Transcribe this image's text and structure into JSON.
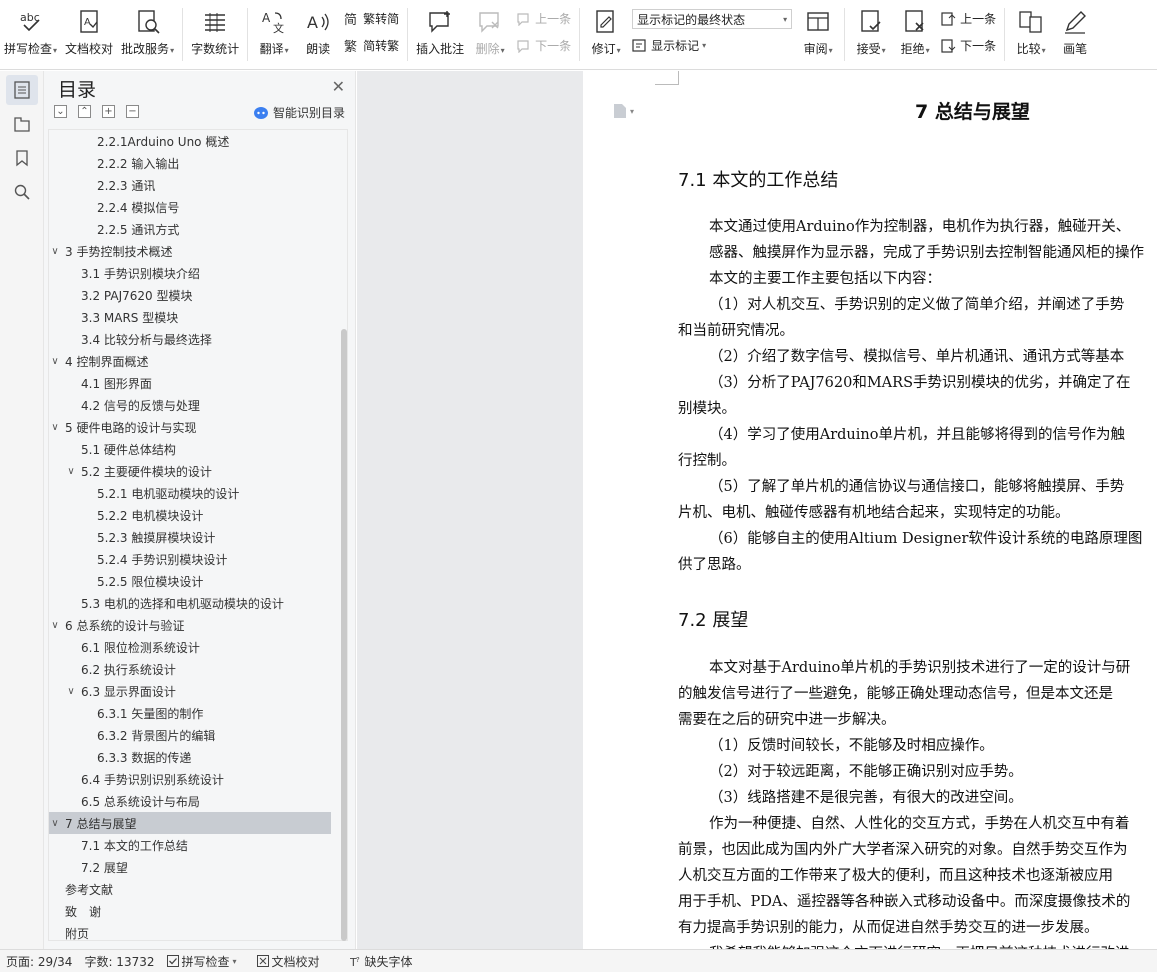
{
  "ribbon": {
    "spell_check": "拼写检查",
    "doc_proof": "文档校对",
    "batch_service": "批改服务",
    "word_count": "字数统计",
    "translate": "翻译",
    "read_aloud": "朗读",
    "trad_to_simp": "繁转简",
    "simp_to_trad": "简转繁",
    "insert_comment": "插入批注",
    "delete": "删除",
    "prev_comment": "上一条",
    "next_comment": "下一条",
    "revise": "修订",
    "markup_mode": "显示标记的最终状态",
    "show_markup": "显示标记",
    "review": "审阅",
    "accept": "接受",
    "reject": "拒绝",
    "prev_change": "上一条",
    "next_change": "下一条",
    "compare": "比较",
    "ink": "画笔"
  },
  "toc": {
    "title": "目录",
    "ai_label": "智能识别目录",
    "items": [
      {
        "text": "2.2.1Arduino Uno 概述",
        "level": 3
      },
      {
        "text": "2.2.2 输入输出",
        "level": 3
      },
      {
        "text": "2.2.3 通讯",
        "level": 3
      },
      {
        "text": "2.2.4 模拟信号",
        "level": 3
      },
      {
        "text": "2.2.5 通讯方式",
        "level": 3
      },
      {
        "text": "3 手势控制技术概述",
        "level": 1,
        "chevron": true
      },
      {
        "text": "3.1 手势识别模块介绍",
        "level": 2
      },
      {
        "text": "3.2 PAJ7620 型模块",
        "level": 2
      },
      {
        "text": "3.3 MARS 型模块",
        "level": 2
      },
      {
        "text": "3.4 比较分析与最终选择",
        "level": 2
      },
      {
        "text": "4 控制界面概述",
        "level": 1,
        "chevron": true
      },
      {
        "text": "4.1 图形界面",
        "level": 2
      },
      {
        "text": "4.2 信号的反馈与处理",
        "level": 2
      },
      {
        "text": "5 硬件电路的设计与实现",
        "level": 1,
        "chevron": true
      },
      {
        "text": "5.1 硬件总体结构",
        "level": 2
      },
      {
        "text": "5.2 主要硬件模块的设计",
        "level": 2,
        "chevron": true
      },
      {
        "text": "5.2.1 电机驱动模块的设计",
        "level": 3
      },
      {
        "text": "5.2.2 电机模块设计",
        "level": 3
      },
      {
        "text": "5.2.3 触摸屏模块设计",
        "level": 3
      },
      {
        "text": "5.2.4 手势识别模块设计",
        "level": 3
      },
      {
        "text": "5.2.5 限位模块设计",
        "level": 3
      },
      {
        "text": "5.3 电机的选择和电机驱动模块的设计",
        "level": 2
      },
      {
        "text": "6 总系统的设计与验证",
        "level": 1,
        "chevron": true
      },
      {
        "text": "6.1 限位检测系统设计",
        "level": 2
      },
      {
        "text": "6.2 执行系统设计",
        "level": 2
      },
      {
        "text": "6.3 显示界面设计",
        "level": 2,
        "chevron": true
      },
      {
        "text": "6.3.1 矢量图的制作",
        "level": 3
      },
      {
        "text": "6.3.2 背景图片的编辑",
        "level": 3
      },
      {
        "text": "6.3.3 数据的传递",
        "level": 3
      },
      {
        "text": "6.4 手势识别识别系统设计",
        "level": 2
      },
      {
        "text": "6.5 总系统设计与布局",
        "level": 2
      },
      {
        "text": "7 总结与展望",
        "level": 1,
        "chevron": true,
        "selected": true
      },
      {
        "text": "7.1 本文的工作总结",
        "level": 2
      },
      {
        "text": "7.2 展望",
        "level": 2
      },
      {
        "text": "参考文献",
        "level": 1
      },
      {
        "text": "致　谢",
        "level": 1
      },
      {
        "text": "附页",
        "level": 1
      }
    ]
  },
  "document": {
    "chapter_title": "7  总结与展望",
    "section1_title": "7.1 本文的工作总结",
    "lines": [
      "本文通过使用Arduino作为控制器，电机作为执行器，触碰开关、",
      "感器、触摸屏作为显示器，完成了手势识别去控制智能通风柜的操作",
      "本文的主要工作主要包括以下内容：",
      "（1）对人机交互、手势识别的定义做了简单介绍，并阐述了手势",
      "和当前研究情况。",
      "（2）介绍了数字信号、模拟信号、单片机通讯、通讯方式等基本",
      "（3）分析了PAJ7620和MARS手势识别模块的优劣，并确定了在",
      "别模块。",
      "（4）学习了使用Arduino单片机，并且能够将得到的信号作为触",
      "行控制。",
      "（5）了解了单片机的通信协议与通信接口，能够将触摸屏、手势",
      "片机、电机、触碰传感器有机地结合起来，实现特定的功能。",
      "（6）能够自主的使用Altium Designer软件设计系统的电路原理图",
      "供了思路。"
    ],
    "section2_title": "7.2 展望",
    "lines2": [
      "本文对基于Arduino单片机的手势识别技术进行了一定的设计与研",
      "的触发信号进行了一些避免，能够正确处理动态信号，但是本文还是",
      "需要在之后的研究中进一步解决。",
      "（1）反馈时间较长，不能够及时相应操作。",
      "（2）对于较远距离，不能够正确识别对应手势。",
      "（3）线路搭建不是很完善，有很大的改进空间。",
      "作为一种便捷、自然、人性化的交互方式，手势在人机交互中有着",
      "前景，也因此成为国内外广大学者深入研究的对象。自然手势交互作为",
      "人机交互方面的工作带来了极大的便利，而且这种技术也逐渐被应用",
      "用于手机、PDA、遥控器等各种嵌入式移动设备中。而深度摄像技术的",
      "有力提高手势识别的能力，从而促进自然手势交互的进一步发展。",
      "我希望我能够加强这个方面进行研究，再把目前这种技术进行改进"
    ]
  },
  "status": {
    "page": "页面: 29/34",
    "words": "字数: 13732",
    "spell_check": "拼写检查",
    "doc_proof": "文档校对",
    "missing_font": "缺失字体"
  }
}
